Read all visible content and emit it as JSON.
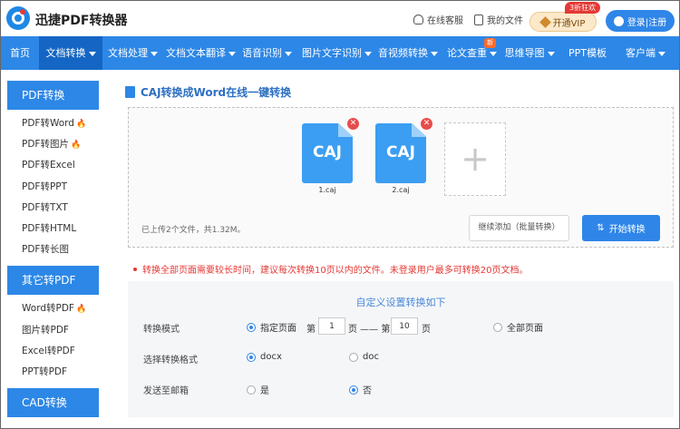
{
  "header": {
    "brand": "迅捷PDF转换器",
    "online_service": "在线客服",
    "my_files": "我的文件",
    "vip_label": "开通VIP",
    "vip_badge": "3折狂欢",
    "login_label": "登录|注册"
  },
  "nav": {
    "items": [
      {
        "label": "首页",
        "dropdown": false
      },
      {
        "label": "文档转换",
        "dropdown": true,
        "active": true
      },
      {
        "label": "文档处理",
        "dropdown": true
      },
      {
        "label": "文档文本翻译",
        "dropdown": true
      },
      {
        "label": "语音识别",
        "dropdown": true
      },
      {
        "label": "图片文字识别",
        "dropdown": true
      },
      {
        "label": "音视频转换",
        "dropdown": true
      },
      {
        "label": "论文查重",
        "dropdown": true,
        "badge": "新"
      },
      {
        "label": "思维导图",
        "dropdown": true
      },
      {
        "label": "PPT模板",
        "dropdown": false
      },
      {
        "label": "客户端",
        "dropdown": true
      }
    ]
  },
  "sidebar": {
    "sections": [
      {
        "title": "PDF转换",
        "items": [
          {
            "label": "PDF转Word",
            "hot": true
          },
          {
            "label": "PDF转图片",
            "hot": true
          },
          {
            "label": "PDF转Excel",
            "hot": false
          },
          {
            "label": "PDF转PPT",
            "hot": false
          },
          {
            "label": "PDF转TXT",
            "hot": false
          },
          {
            "label": "PDF转HTML",
            "hot": false
          },
          {
            "label": "PDF转长图",
            "hot": false
          }
        ]
      },
      {
        "title": "其它转PDF",
        "items": [
          {
            "label": "Word转PDF",
            "hot": true
          },
          {
            "label": "图片转PDF",
            "hot": false
          },
          {
            "label": "Excel转PDF",
            "hot": false
          },
          {
            "label": "PPT转PDF",
            "hot": false
          }
        ]
      },
      {
        "title": "CAD转换",
        "items": []
      }
    ]
  },
  "main": {
    "title": "CAJ转换成Word在线一键转换",
    "files": [
      {
        "type": "CAJ",
        "name": "1.caj"
      },
      {
        "type": "CAJ",
        "name": "2.caj"
      }
    ],
    "add_symbol": "+",
    "upload_info": "已上传2个文件，共1.32M。",
    "continue_label": "继续添加（批量转换）",
    "start_label": "开始转换",
    "notice": "转换全部页面需要较长时间，建议每次转换10页以内的文件。未登录用户最多可转换20页文档。"
  },
  "settings": {
    "title": "自定义设置转换如下",
    "mode_label": "转换模式",
    "mode_specify": "指定页面",
    "page_prefix": "第",
    "page_from": "1",
    "page_mid": "页 —— 第",
    "page_to": "10",
    "page_suffix": "页",
    "mode_all": "全部页面",
    "format_label": "选择转换格式",
    "format_docx": "docx",
    "format_doc": "doc",
    "email_label": "发送至邮箱",
    "email_yes": "是",
    "email_no": "否"
  },
  "colors": {
    "accent": "#2d87e6",
    "nav_active": "#1566c4",
    "notice": "#e53935"
  }
}
